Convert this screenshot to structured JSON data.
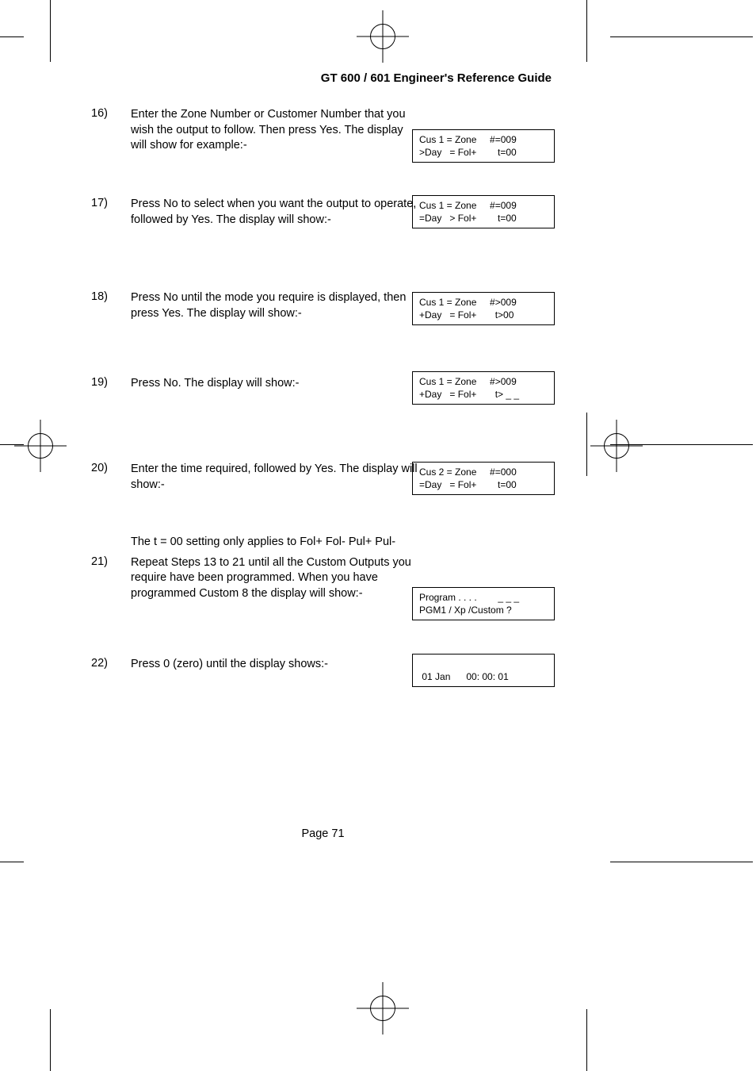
{
  "header": "GT 600 / 601 Engineer's Reference Guide",
  "steps": {
    "s16": {
      "num": "16)",
      "text": "Enter the Zone Number or Customer Number that you wish the output to follow. Then press Yes. The display will show for example:-",
      "disp_l1": "Cus 1 = Zone     #=009",
      "disp_l2": ">Day   = Fol+        t=00"
    },
    "s17": {
      "num": "17)",
      "text": "Press No to select when you want the output to operate, followed by Yes. The display will show:-",
      "disp_l1": "Cus 1 = Zone     #=009",
      "disp_l2": "=Day   > Fol+        t=00"
    },
    "s18": {
      "num": "18)",
      "text": "Press No until the mode you require is displayed, then press Yes. The display will show:-",
      "disp_l1": "Cus 1 = Zone     #>009",
      "disp_l2": "+Day   = Fol+       t>00"
    },
    "s19": {
      "num": "19)",
      "text": "Press No. The display will show:-",
      "disp_l1": "Cus 1 = Zone     #>009",
      "disp_l2": "+Day   = Fol+       t> _ _"
    },
    "s20": {
      "num": "20)",
      "text": "Enter the time required, followed by Yes. The display will show:-",
      "disp_l1": "Cus 2 = Zone     #=000",
      "disp_l2": "=Day   = Fol+        t=00"
    },
    "note": "The t = 00 setting only applies to Fol+ Fol- Pul+ Pul-",
    "s21": {
      "num": "21)",
      "text": "Repeat Steps 13 to 21 until all the Custom Outputs you require have been programmed. When you have programmed Custom 8 the display will show:-",
      "disp_l1": "Program . . . .        _ _ _",
      "disp_l2": "PGM1 / Xp /Custom ?"
    },
    "s22": {
      "num": "22)",
      "text": "Press 0 (zero) until the display shows:-",
      "disp_l1": " ",
      "disp_l2": " 01 Jan      00: 00: 01"
    }
  },
  "footer": "Page  71"
}
